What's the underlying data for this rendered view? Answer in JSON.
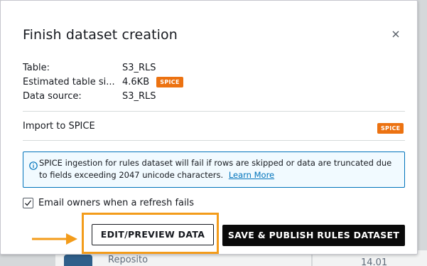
{
  "modal": {
    "title": "Finish dataset creation",
    "info": [
      {
        "label": "Table:",
        "value": "S3_RLS"
      },
      {
        "label": "Estimated table si...",
        "value": "4.6KB",
        "badge": "SPICE"
      },
      {
        "label": "Data source:",
        "value": "S3_RLS"
      }
    ],
    "import_label": "Import to SPICE",
    "import_badge": "SPICE",
    "alert": {
      "text": "SPICE ingestion for rules dataset will fail if rows are skipped or data are truncated due to fields exceeding 2047 unicode characters.",
      "link": "Learn More"
    },
    "checkbox": {
      "label": "Email owners when a refresh fails",
      "checked": true
    },
    "buttons": {
      "edit_preview": "EDIT/PREVIEW DATA",
      "save_publish": "SAVE & PUBLISH RULES DATASET"
    }
  },
  "background": {
    "partial_text_1": "Reposito",
    "partial_text_2": "14.01"
  },
  "colors": {
    "badge": "#ec7211",
    "alert_border": "#0073bb",
    "alert_bg": "#f1faff",
    "link": "#0073bb",
    "highlight": "#f39c1b",
    "primary_button": "#0a0a0a"
  },
  "icons": {
    "close": "close-icon",
    "info": "info-icon",
    "check": "check-icon",
    "arrow": "arrow-right-icon"
  }
}
